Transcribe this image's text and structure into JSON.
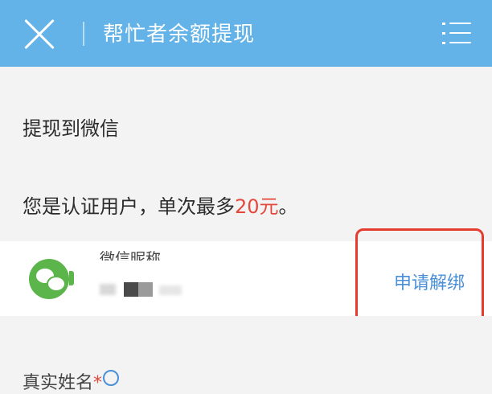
{
  "header": {
    "title": "帮忙者余额提现"
  },
  "withdraw": {
    "section_title": "提现到微信",
    "notice_prefix": "您是认证用户，单次最多",
    "notice_amount": "20元",
    "notice_suffix": "。"
  },
  "account": {
    "nickname_label": "微信昵称",
    "unbind_label": "申请解绑"
  },
  "form": {
    "realname_label": "真实姓名",
    "required_mark": "*"
  },
  "colors": {
    "header_bg": "#63b3e8",
    "accent_link": "#4a90d9",
    "amount": "#e4483b",
    "highlight_box": "#e53c2e",
    "wechat_green": "#5bb54a"
  }
}
